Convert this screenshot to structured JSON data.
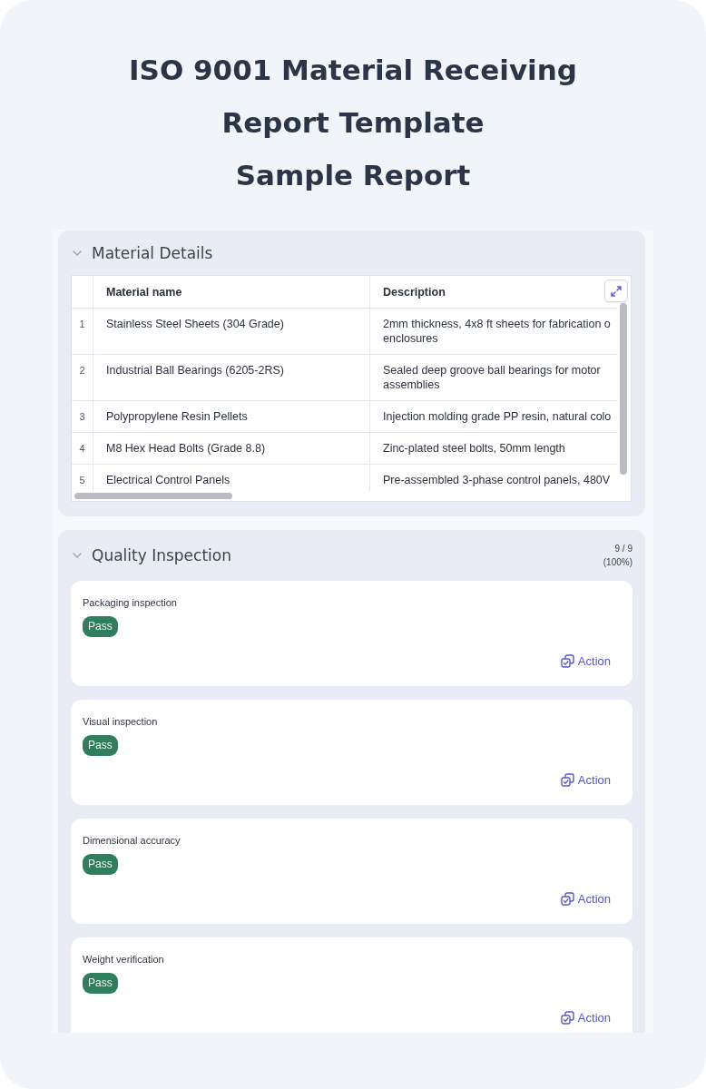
{
  "header": {
    "title": "ISO 9001 Material Receiving Report Template",
    "subtitle": "Sample Report"
  },
  "sections": [
    {
      "kind": "table",
      "title": "Material Details",
      "expanded": true,
      "table": {
        "columns": [
          "Material name",
          "Description"
        ],
        "rows": [
          {
            "number": "1",
            "cells": [
              "Stainless Steel Sheets (304 Grade)",
              "2mm thickness, 4x8 ft sheets for fabrication o\nenclosures"
            ]
          },
          {
            "number": "2",
            "cells": [
              "Industrial Ball Bearings (6205-2RS)",
              "Sealed deep groove ball bearings for motor assemblies"
            ]
          },
          {
            "number": "3",
            "cells": [
              "Polypropylene Resin Pellets",
              "Injection molding grade PP resin, natural colo"
            ]
          },
          {
            "number": "4",
            "cells": [
              "M8 Hex Head Bolts (Grade 8.8)",
              "Zinc-plated steel bolts, 50mm length"
            ]
          },
          {
            "number": "5",
            "cells": [
              "Electrical Control Panels",
              "Pre-assembled 3-phase control panels, 480V"
            ]
          }
        ]
      }
    },
    {
      "kind": "checklist",
      "title": "Quality Inspection",
      "expanded": true,
      "progress_count": "9 / 9",
      "progress_percent": "(100%)",
      "items": [
        {
          "label": "Packaging inspection",
          "result": "Pass",
          "action": "Action"
        },
        {
          "label": "Visual inspection",
          "result": "Pass",
          "action": "Action"
        },
        {
          "label": "Dimensional accuracy",
          "result": "Pass",
          "action": "Action"
        },
        {
          "label": "Weight verification",
          "result": "Pass",
          "action": "Action"
        }
      ]
    }
  ]
}
